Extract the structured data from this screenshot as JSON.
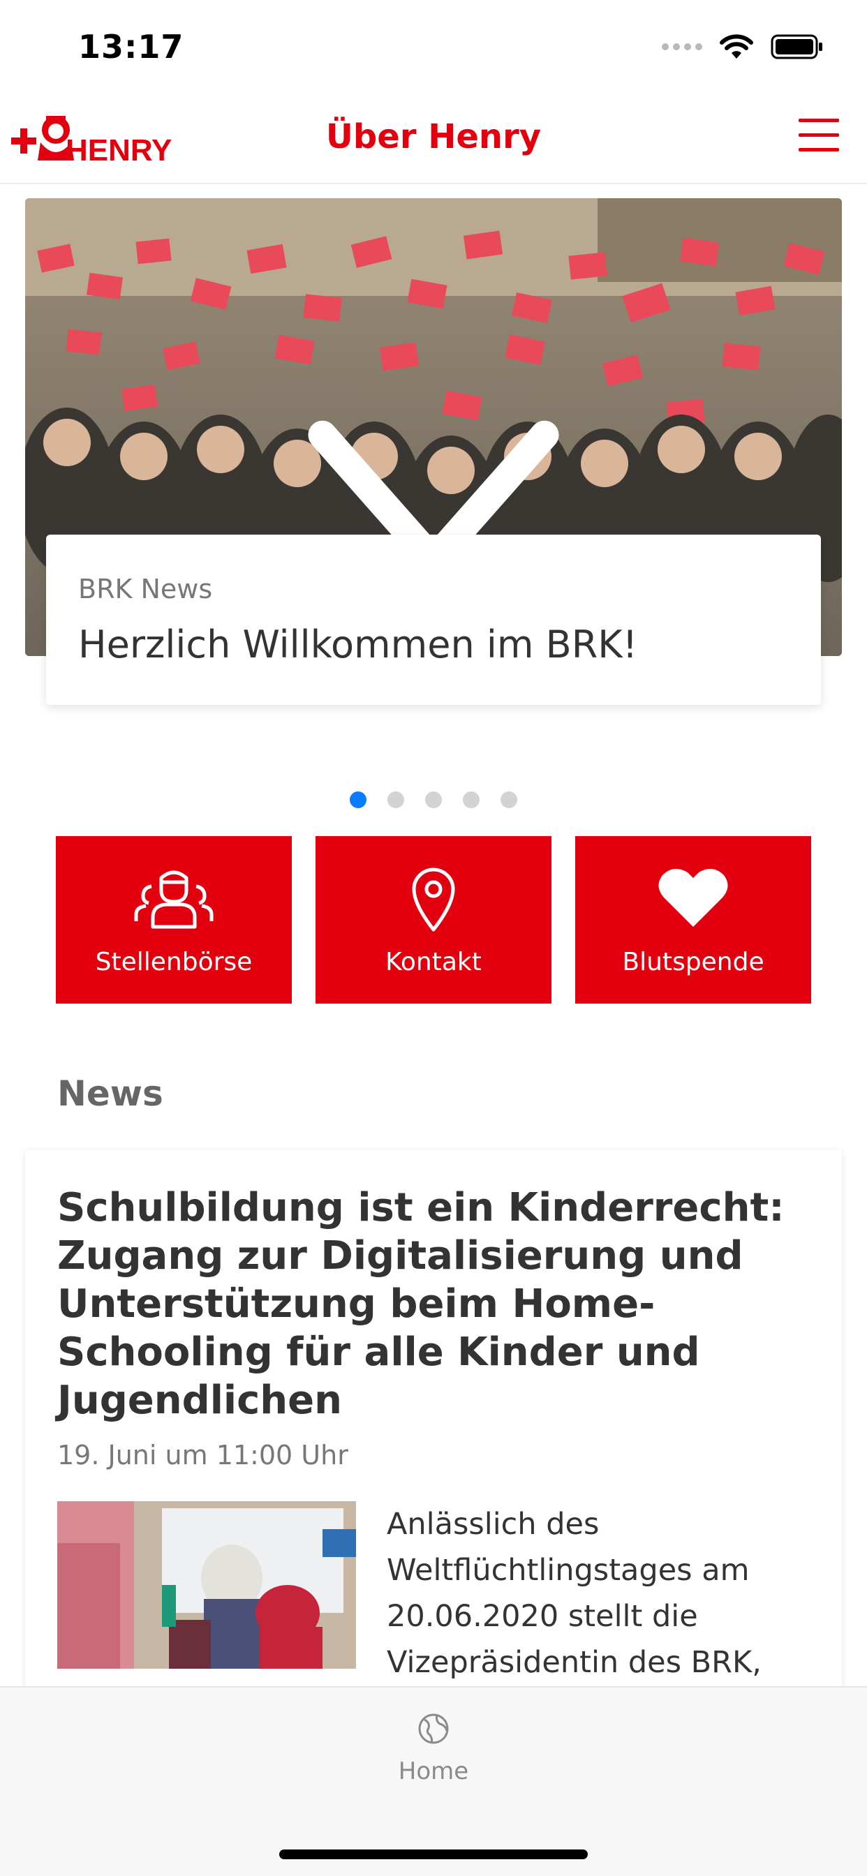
{
  "status_bar": {
    "time": "13:17"
  },
  "nav": {
    "title": "Über Henry",
    "logo_text": "HENRY"
  },
  "hero": {
    "category": "BRK News",
    "title": "Herzlich Willkommen im BRK!",
    "slide_count": 5,
    "active_slide": 1
  },
  "tiles": [
    {
      "label": "Stellenbörse",
      "icon": "team-icon"
    },
    {
      "label": "Kontakt",
      "icon": "location-pin-icon"
    },
    {
      "label": "Blutspende",
      "icon": "heart-icon"
    }
  ],
  "news_section": {
    "title": "News"
  },
  "news": [
    {
      "title": "Schulbildung ist ein Kinderrecht: Zugang zur Digitalisierung und Unterstützung beim Home-Schooling für alle Kinder und Jugendlichen",
      "date": "19. Juni um 11:00 Uhr",
      "excerpt": "Anlässlich des Weltflüchtlingstages am 20.06.2020 stellt die Vizepräsidentin des BRK, Brigitte Meyer, das dreijährige Projekt „Starkes"
    }
  ],
  "tab_bar": {
    "home_label": "Home"
  },
  "colors": {
    "brand_red": "#e2000f",
    "active_dot": "#0a7cff",
    "tab_inactive": "#8a8a8a"
  }
}
